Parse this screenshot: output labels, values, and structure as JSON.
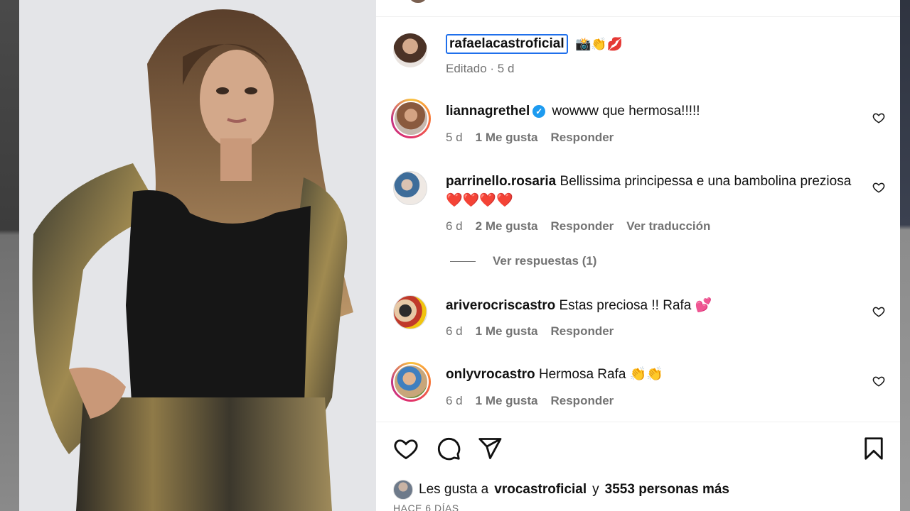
{
  "post": {
    "caption": {
      "username": "rafaelacastroficial",
      "emojis": "📸👏💋",
      "meta": "Editado · 5 d"
    },
    "comments": [
      {
        "username": "liannagrethel",
        "verified": true,
        "text": "wowww que hermosa!!!!!",
        "time": "5 d",
        "likes": "1 Me gusta",
        "reply": "Responder"
      },
      {
        "username": "parrinello.rosaria",
        "text": "Bellissima principessa e una bambolina preziosa ❤️❤️❤️❤️",
        "time": "6 d",
        "likes": "2 Me gusta",
        "reply": "Responder",
        "translate": "Ver traducción",
        "view_replies": "Ver respuestas (1)"
      },
      {
        "username": "ariverocriscastro",
        "text": "Estas preciosa !! Rafa 💕",
        "time": "6 d",
        "likes": "1 Me gusta",
        "reply": "Responder"
      },
      {
        "username": "onlyvrocastro",
        "text": "Hermosa Rafa 👏👏",
        "time": "6 d",
        "likes": "1 Me gusta",
        "reply": "Responder"
      }
    ],
    "likes": {
      "prefix": "Les gusta a",
      "user": "vrocastroficial",
      "connector": "y",
      "others": "3553 personas más"
    },
    "time_ago": "HACE 6 DÍAS"
  },
  "icons": {
    "like": "heart-icon",
    "comment": "comment-icon",
    "share": "share-icon",
    "save": "bookmark-icon",
    "comment_like": "heart-icon"
  },
  "colors": {
    "accent_focus": "#1f6feb",
    "verified": "#1d9bf0",
    "muted_text": "#737373"
  }
}
